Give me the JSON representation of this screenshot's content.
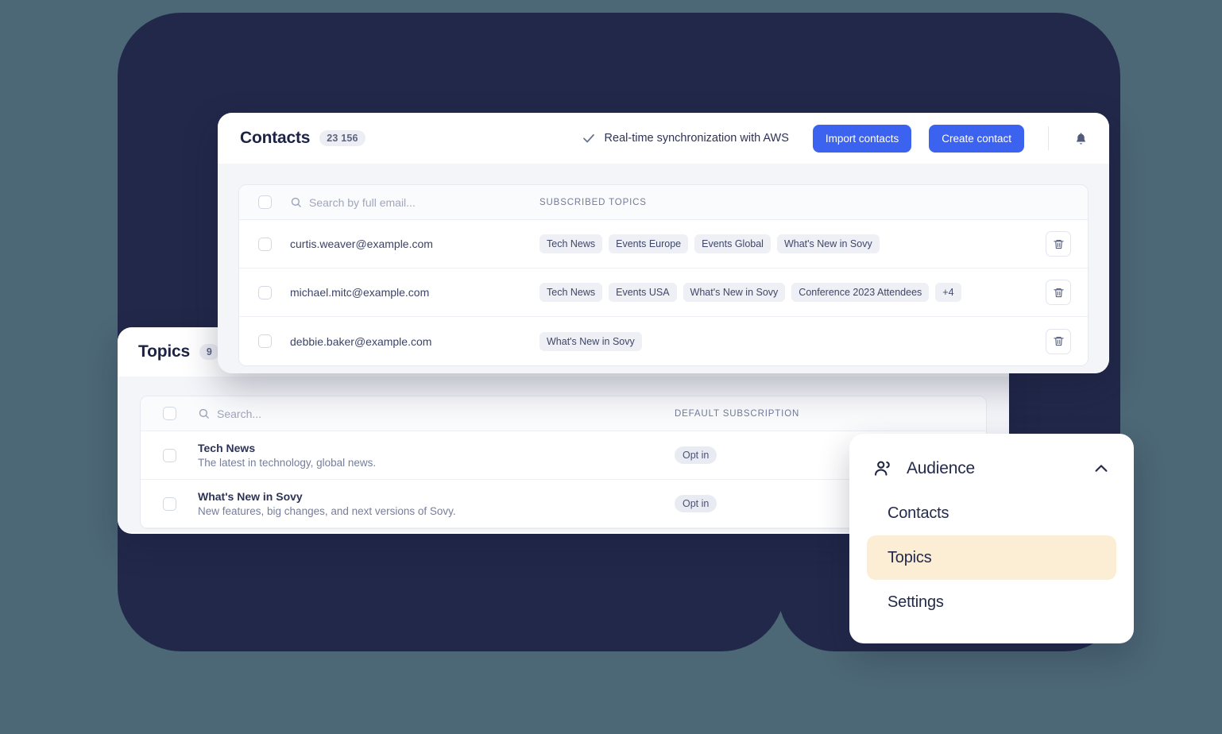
{
  "background": {
    "page_color": "#4c6775",
    "blob_color": "#222849",
    "accent_blue": "#3c63f0",
    "highlight_cream": "#fceed5"
  },
  "contacts_panel": {
    "title": "Contacts",
    "count": "23 156",
    "sync_label": "Real-time synchronization with AWS",
    "check_icon": "check-icon",
    "import_button": "Import contacts",
    "create_button": "Create contact",
    "bell_icon": "bell-icon",
    "search_placeholder": "Search by full email...",
    "search_value": "",
    "search_icon": "search-icon",
    "column_topics": "SUBSCRIBED TOPICS",
    "delete_icon": "trash-icon",
    "rows": [
      {
        "email": "curtis.weaver@example.com",
        "topics": [
          "Tech News",
          "Events Europe",
          "Events Global",
          "What's New in Sovy"
        ]
      },
      {
        "email": "michael.mitc@example.com",
        "topics": [
          "Tech News",
          "Events USA",
          "What's New in Sovy",
          "Conference 2023 Attendees",
          "+4"
        ]
      },
      {
        "email": "debbie.baker@example.com",
        "topics": [
          "What's New in Sovy"
        ]
      }
    ]
  },
  "topics_panel": {
    "title": "Topics",
    "count": "9",
    "search_placeholder": "Search...",
    "search_value": "",
    "search_icon": "search-icon",
    "column_subscription": "DEFAULT SUBSCRIPTION",
    "rows": [
      {
        "name": "Tech News",
        "description": "The latest in technology, global news.",
        "subscription": "Opt in"
      },
      {
        "name": "What's New in Sovy",
        "description": "New features, big changes, and next versions of Sovy.",
        "subscription": "Opt in"
      }
    ]
  },
  "audience_menu": {
    "group_label": "Audience",
    "group_icon": "users-icon",
    "chevron_icon": "chevron-up-icon",
    "items": [
      {
        "label": "Contacts",
        "active": false
      },
      {
        "label": "Topics",
        "active": true
      },
      {
        "label": "Settings",
        "active": false
      }
    ]
  }
}
